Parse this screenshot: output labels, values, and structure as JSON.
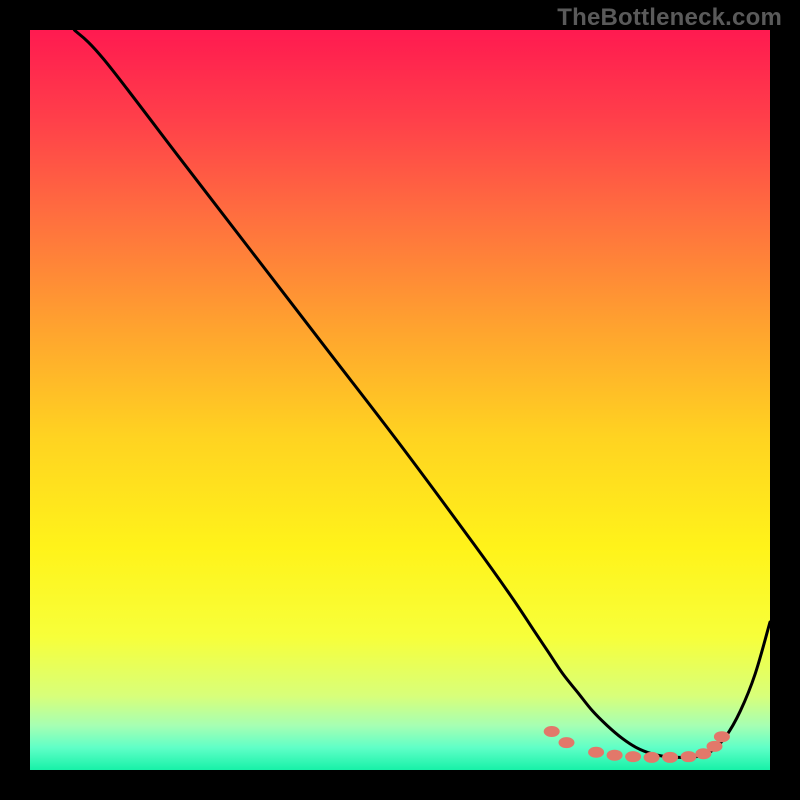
{
  "watermark": "TheBottleneck.com",
  "chart_data": {
    "type": "line",
    "title": "",
    "xlabel": "",
    "ylabel": "",
    "xlim": [
      0,
      100
    ],
    "ylim": [
      0,
      100
    ],
    "grid": false,
    "legend": false,
    "series": [
      {
        "name": "curve",
        "x": [
          6,
          10,
          20,
          30,
          40,
          50,
          60,
          65,
          68,
          70,
          72,
          74,
          76,
          78,
          80,
          82,
          84,
          86,
          88,
          90,
          92,
          94,
          96,
          98,
          100
        ],
        "y": [
          100,
          96,
          83,
          70,
          57,
          44,
          30.5,
          23.5,
          19,
          16,
          13,
          10.5,
          8,
          6,
          4.3,
          3,
          2.2,
          1.8,
          1.7,
          1.8,
          2.5,
          4.5,
          8,
          13,
          20
        ],
        "color": "#000000"
      }
    ],
    "markers": [
      {
        "x": 70.5,
        "y": 5.2
      },
      {
        "x": 72.5,
        "y": 3.7
      },
      {
        "x": 76.5,
        "y": 2.4
      },
      {
        "x": 79.0,
        "y": 2.0
      },
      {
        "x": 81.5,
        "y": 1.8
      },
      {
        "x": 84.0,
        "y": 1.7
      },
      {
        "x": 86.5,
        "y": 1.7
      },
      {
        "x": 89.0,
        "y": 1.8
      },
      {
        "x": 91.0,
        "y": 2.2
      },
      {
        "x": 92.5,
        "y": 3.2
      },
      {
        "x": 93.5,
        "y": 4.5
      }
    ],
    "marker_color": "#e2786a",
    "background": {
      "type": "vertical-gradient",
      "stops": [
        {
          "pos": 0.0,
          "color": "#ff1a50"
        },
        {
          "pos": 0.12,
          "color": "#ff3f4a"
        },
        {
          "pos": 0.25,
          "color": "#ff6e3f"
        },
        {
          "pos": 0.4,
          "color": "#ffa22f"
        },
        {
          "pos": 0.55,
          "color": "#ffd321"
        },
        {
          "pos": 0.7,
          "color": "#fff31a"
        },
        {
          "pos": 0.82,
          "color": "#f7ff3a"
        },
        {
          "pos": 0.9,
          "color": "#d8ff7a"
        },
        {
          "pos": 0.94,
          "color": "#a6ffb3"
        },
        {
          "pos": 0.97,
          "color": "#5fffc7"
        },
        {
          "pos": 1.0,
          "color": "#17f1a8"
        }
      ]
    }
  }
}
